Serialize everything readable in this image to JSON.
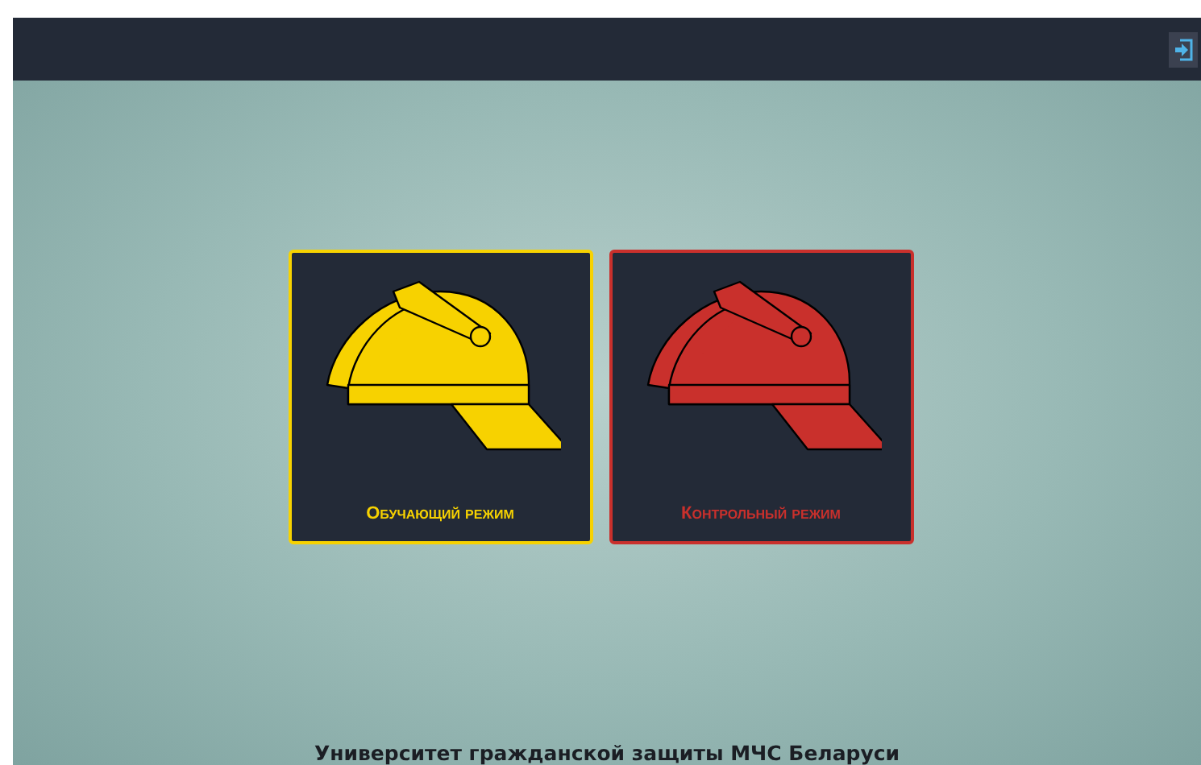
{
  "modes": [
    {
      "label": "Обучающий режим",
      "color": "#f7d200"
    },
    {
      "label": "Контрольный режим",
      "color": "#c9302c"
    }
  ],
  "footer": "Университет гражданской защиты МЧС Беларуси"
}
